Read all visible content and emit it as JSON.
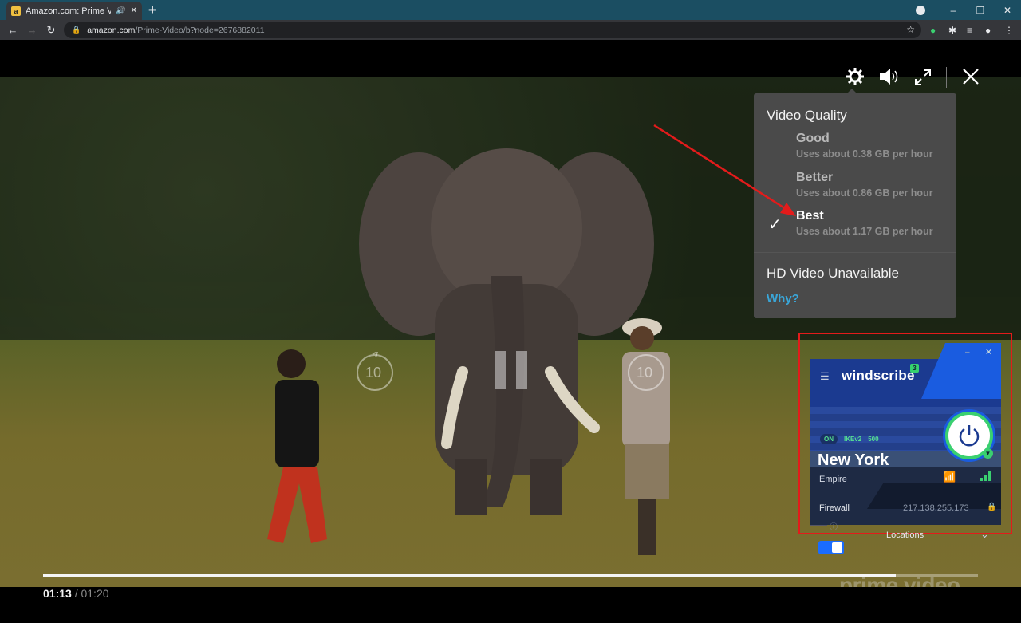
{
  "browser": {
    "tab_title": "Amazon.com: Prime Video: P",
    "favicon": "amazon-a",
    "new_tab": "+",
    "url_host": "amazon.com",
    "url_path": "/Prime-Video/b?node=2676882011",
    "win_minimize": "–",
    "win_restore": "❐",
    "win_close": "✕"
  },
  "player": {
    "controls": {
      "settings": "gear-icon",
      "volume": "volume-icon",
      "fullscreen": "fullscreen-icon",
      "close": "✕"
    },
    "rewind_label": "10",
    "forward_label": "10",
    "progress_fraction": 0.9125,
    "time_current": "01:13",
    "time_separator": " / ",
    "time_total": "01:20",
    "watermark": "prime video"
  },
  "quality_menu": {
    "title": "Video Quality",
    "options": [
      {
        "label": "Good",
        "sub": "Uses about 0.38 GB per hour",
        "selected": false
      },
      {
        "label": "Better",
        "sub": "Uses about 0.86 GB per hour",
        "selected": false
      },
      {
        "label": "Best",
        "sub": "Uses about 1.17 GB per hour",
        "selected": true
      }
    ],
    "check": "✓",
    "hd_title": "HD Video Unavailable",
    "why_link": "Why?"
  },
  "windscribe": {
    "brand": "windscribe",
    "badge": "3",
    "status": "ON",
    "protocol": "IKEv2",
    "port": "500",
    "city": "New York",
    "server": "Empire",
    "firewall_label": "Firewall",
    "ip": "217.138.255.173",
    "locations_label": "Locations",
    "firewall_on": true,
    "colors": {
      "accent": "#3ad070",
      "brand_blue": "#1a5ce0"
    }
  },
  "annotation": {
    "highlight_color": "#e31b1b"
  }
}
